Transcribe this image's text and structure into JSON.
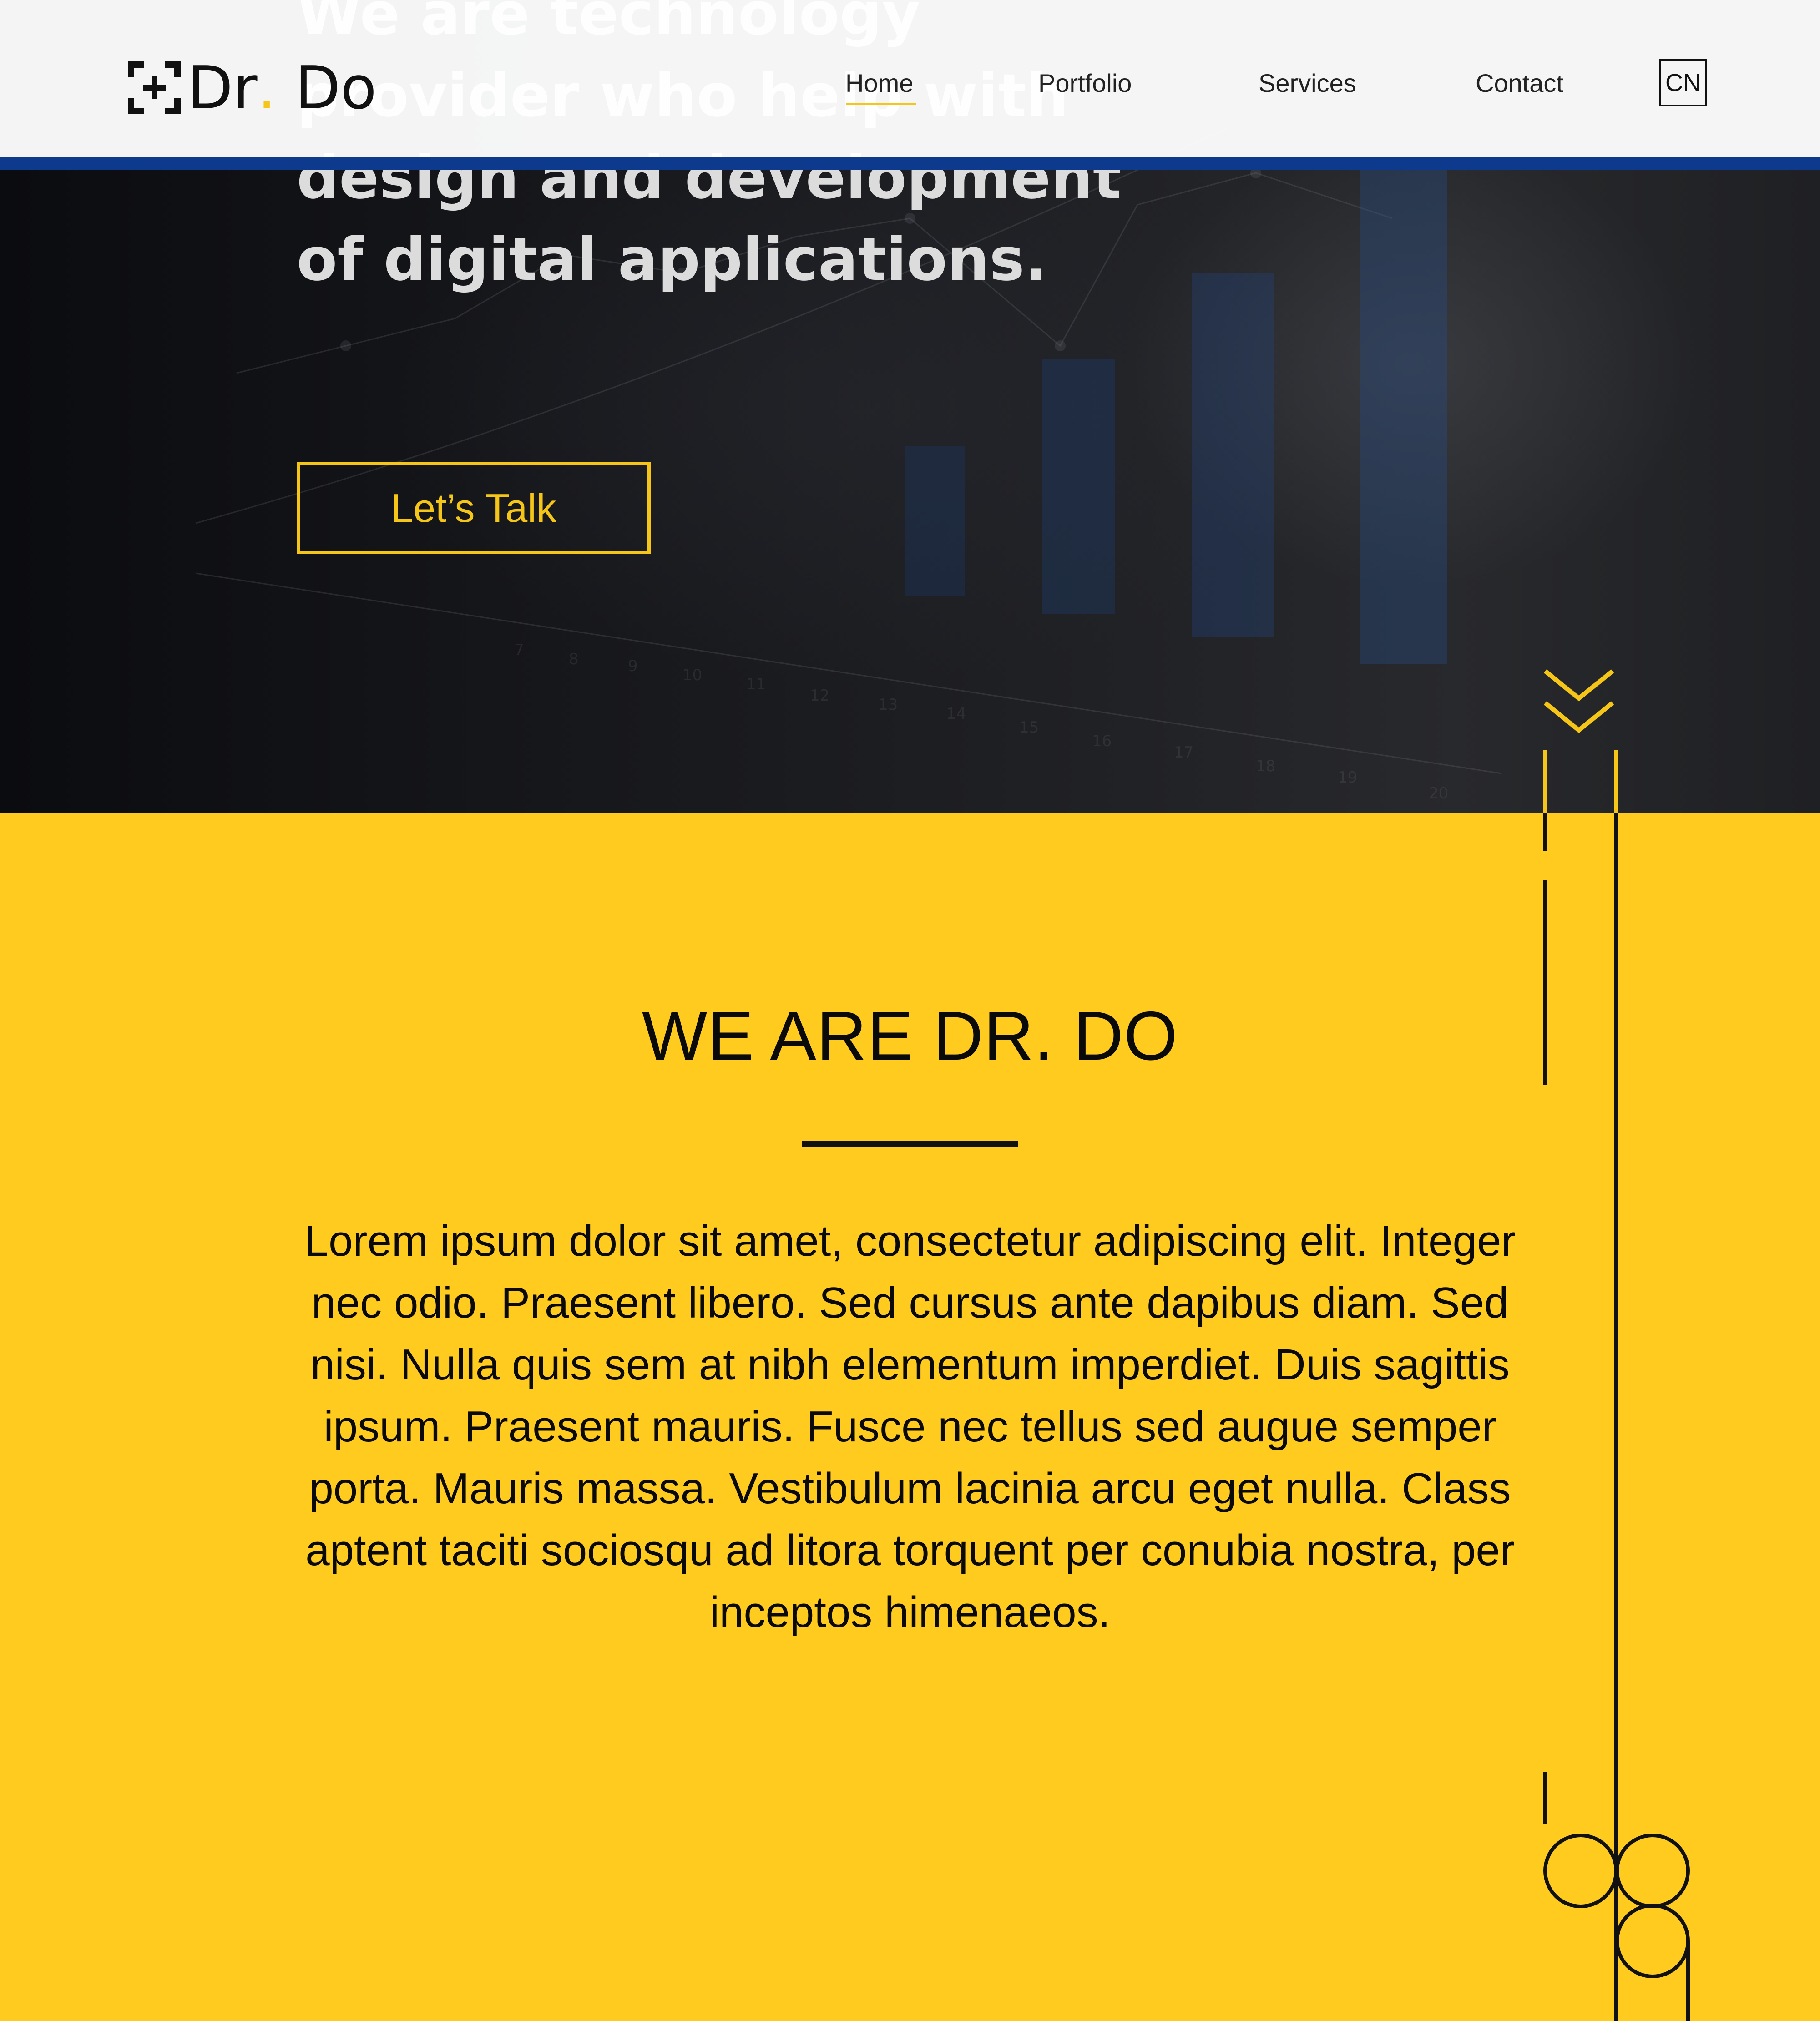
{
  "brand": {
    "name": "Dr. Do",
    "name_part1": "Dr",
    "name_dot": ".",
    "name_part2": " Do",
    "accent_color": "#f5c518",
    "stripe_color": "#0d3a8c"
  },
  "nav": {
    "items": [
      {
        "label": "Home",
        "active": true
      },
      {
        "label": "Portfolio",
        "active": false
      },
      {
        "label": "Services",
        "active": false
      },
      {
        "label": "Contact",
        "active": false
      }
    ],
    "language_button": "CN"
  },
  "hero": {
    "title": "We are technology provider who help with design and development of digital applications.",
    "cta_label": "Let’s Talk",
    "scroll_icon": "double-chevron-down-icon"
  },
  "about": {
    "title": "WE ARE DR. DO",
    "body": "Lorem ipsum dolor sit amet, consectetur adipiscing elit. Integer nec odio. Praesent libero. Sed cursus ante dapibus diam. Sed nisi. Nulla quis sem at nibh elementum imperdiet. Duis sagittis ipsum. Praesent mauris. Fusce nec tellus sed augue semper porta. Mauris massa. Vestibulum lacinia arcu eget nulla. Class aptent taciti sociosqu ad litora torquent per conubia nostra, per inceptos himenaeos."
  }
}
